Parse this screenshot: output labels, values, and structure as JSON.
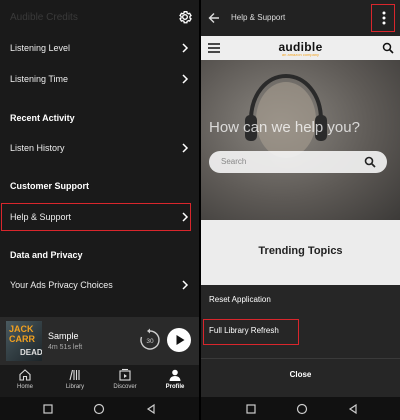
{
  "left": {
    "faint_header": "Audible Credits",
    "rows": {
      "listening_level": "Listening Level",
      "listening_time": "Listening Time",
      "listen_history": "Listen History",
      "help_support": "Help & Support",
      "ads_privacy": "Your Ads Privacy Choices"
    },
    "sections": {
      "recent_activity": "Recent Activity",
      "customer_support": "Customer Support",
      "data_privacy": "Data and Privacy"
    },
    "player": {
      "cover_line1": "JACK",
      "cover_line2": "CARR",
      "cover_line3": "DEAD",
      "title": "Sample",
      "time_left": "4m 51s left",
      "skip_seconds": "30"
    },
    "tabs": {
      "home": "Home",
      "library": "Library",
      "discover": "Discover",
      "profile": "Profile"
    }
  },
  "right": {
    "top_title": "Help & Support",
    "logo": "audible",
    "logo_sub": "an amazon company",
    "hero_text": "How can we help you?",
    "search_placeholder": "Search",
    "trending": "Trending Topics",
    "sheet": {
      "reset": "Reset Application",
      "full_refresh": "Full Library Refresh",
      "close": "Close"
    }
  },
  "colors": {
    "highlight": "#d9262c",
    "accent": "#f5a623"
  }
}
